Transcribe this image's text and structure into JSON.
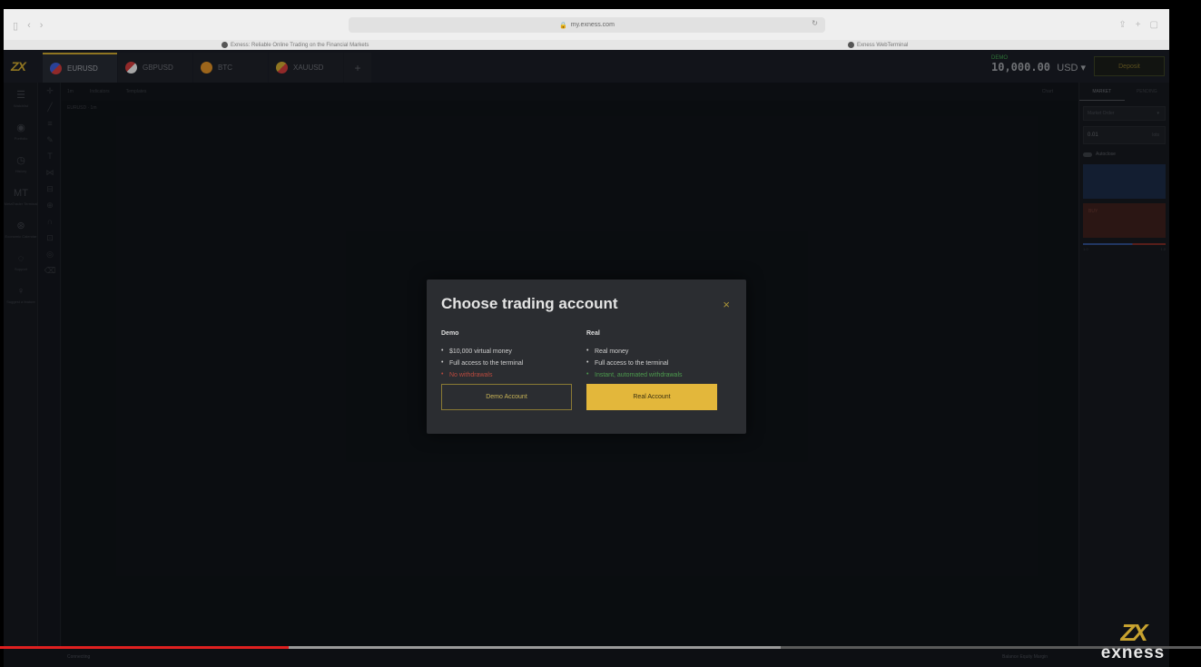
{
  "browser": {
    "url": "my.exness.com",
    "tabs": [
      "Exness: Reliable Online Trading on the Financial Markets",
      "Exness WebTerminal"
    ]
  },
  "app": {
    "logo": "ZX",
    "instrument_tabs": [
      {
        "label": "EURUSD"
      },
      {
        "label": "GBPUSD"
      },
      {
        "label": "BTC"
      },
      {
        "label": "XAUUSD"
      }
    ],
    "add_tab": "+",
    "account": {
      "type": "DEMO",
      "balance": "10,000.00",
      "currency": "USD ▾"
    },
    "deposit_label": "Deposit",
    "left_nav": [
      {
        "icon": "☰",
        "label": "Watchlist"
      },
      {
        "icon": "◉",
        "label": "Portfolio"
      },
      {
        "icon": "◷",
        "label": "History"
      },
      {
        "icon": "MT",
        "label": "MetaTrader Terminal"
      },
      {
        "icon": "⊛",
        "label": "Economic Calendar"
      },
      {
        "icon": "◌",
        "label": "Support"
      },
      {
        "icon": "♀",
        "label": "Suggest a feature"
      }
    ],
    "chart_toolbar": {
      "timeframe": "1m",
      "indicators": "Indicators",
      "templates": "Templates",
      "right": "Chart"
    },
    "chart_legend": "EURUSD · 1m",
    "right_panel": {
      "tabs": [
        "MARKET",
        "PENDING"
      ],
      "order_type": "Market Order",
      "volume": "0.01",
      "volume_unit": "lots",
      "toggle_label": "Autoclose",
      "buy_label": "BUY",
      "spread_left": "1.0",
      "spread_right": "1.0"
    },
    "bottom": {
      "left": "Connecting",
      "right": "Balance  Equity  Margin"
    }
  },
  "modal": {
    "title": "Choose trading account",
    "close": "×",
    "demo": {
      "heading": "Demo",
      "features": [
        "$10,000 virtual money",
        "Full access to the terminal",
        "No withdrawals"
      ],
      "button": "Demo Account"
    },
    "real": {
      "heading": "Real",
      "features": [
        "Real money",
        "Full access to the terminal",
        "Instant, automated withdrawals"
      ],
      "button": "Real Account"
    }
  },
  "video": {
    "played_fraction": 0.24,
    "buffered_fraction": 0.65
  },
  "watermark": {
    "mark": "ZX",
    "word": "exness"
  },
  "colors": {
    "accent": "#e3b73b",
    "negative": "#b94a3e",
    "positive": "#4c9a4d",
    "background": "#11141a"
  }
}
